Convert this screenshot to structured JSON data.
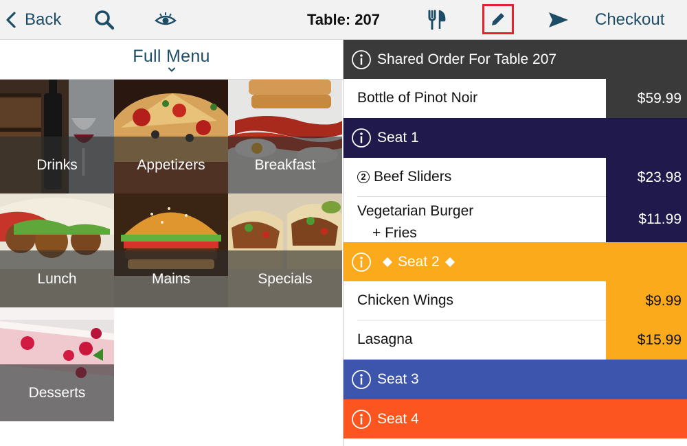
{
  "toolbar": {
    "back_label": "Back",
    "title": "Table: 207",
    "checkout_label": "Checkout",
    "icons": [
      "chevron-left-icon",
      "search-icon",
      "eye-icon",
      "fork-knife-icon",
      "pencil-icon",
      "send-icon"
    ],
    "accent_color": "#1d4c66",
    "edit_highlight_color": "#e5222b"
  },
  "menu": {
    "title": "Full Menu",
    "categories": [
      {
        "label": "Drinks"
      },
      {
        "label": "Appetizers"
      },
      {
        "label": "Breakfast"
      },
      {
        "label": "Lunch"
      },
      {
        "label": "Mains"
      },
      {
        "label": "Specials"
      },
      {
        "label": "Desserts"
      }
    ]
  },
  "order": {
    "shared_header": "Shared Order For Table 207",
    "shared_items": [
      {
        "name": "Bottle of Pinot Noir",
        "price": "$59.99"
      }
    ],
    "seats": [
      {
        "label": "Seat 1",
        "color": "#201a4c",
        "items": [
          {
            "qty": "2",
            "name": "Beef Sliders",
            "price": "$23.98"
          },
          {
            "name": "Vegetarian Burger",
            "modifier": "+ Fries",
            "price": "$11.99"
          }
        ]
      },
      {
        "label": "Seat 2",
        "color": "#fbaa1c",
        "selected": true,
        "items": [
          {
            "name": "Chicken Wings",
            "price": "$9.99"
          },
          {
            "name": "Lasagna",
            "price": "$15.99"
          }
        ]
      },
      {
        "label": "Seat 3",
        "color": "#3d55ad",
        "items": []
      },
      {
        "label": "Seat 4",
        "color": "#fd5520",
        "items": []
      }
    ],
    "colors": {
      "shared_header": "#3a3a3a",
      "shared_price_bg": "#3a3a3a",
      "text": "#111111"
    }
  }
}
